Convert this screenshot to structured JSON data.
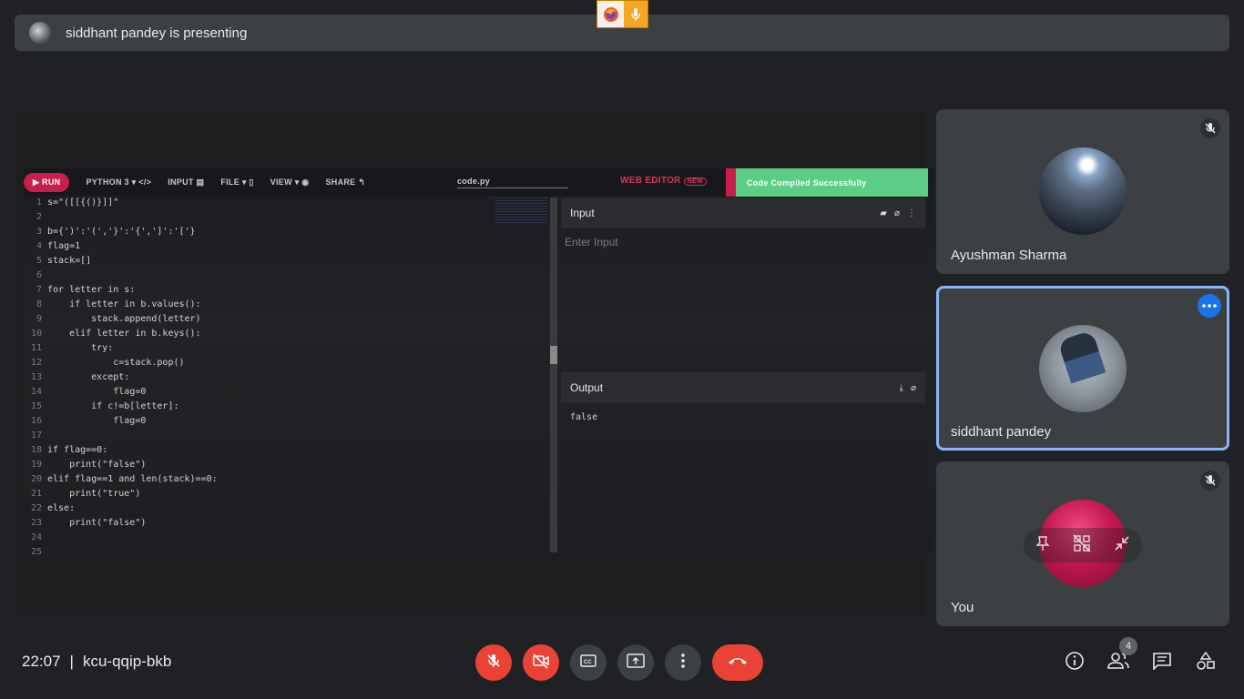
{
  "banner": {
    "text": "siddhant pandey is presenting"
  },
  "toolbar": {
    "run": "RUN",
    "language": "PYTHON 3",
    "input": "INPUT",
    "file": "FILE",
    "view": "VIEW",
    "share": "SHARE",
    "filename": "code.py",
    "brand": "WEB EDITOR",
    "brand_badge": "NEW",
    "status": "Code Compiled Successfully"
  },
  "code": {
    "lines": [
      "s=\"([[{()}]]\"",
      "",
      "b={')':'(','}':'{',']':'['}",
      "flag=1",
      "stack=[]",
      "",
      "for letter in s:",
      "    if letter in b.values():",
      "        stack.append(letter)",
      "    elif letter in b.keys():",
      "        try:",
      "            c=stack.pop()",
      "        except:",
      "            flag=0",
      "        if c!=b[letter]:",
      "            flag=0",
      "",
      "if flag==0:",
      "    print(\"false\")",
      "elif flag==1 and len(stack)==0:",
      "    print(\"true\")",
      "else:",
      "    print(\"false\")",
      "",
      ""
    ]
  },
  "io": {
    "input_title": "Input",
    "input_placeholder": "Enter Input",
    "output_title": "Output",
    "output_value": "false"
  },
  "participants": [
    {
      "name": "Ayushman Sharma"
    },
    {
      "name": "siddhant pandey"
    },
    {
      "name": "You"
    }
  ],
  "meeting": {
    "time": "22:07",
    "separator": "|",
    "code": "kcu-qqip-bkb"
  },
  "people_count": "4",
  "colors": {
    "accent": "#8ab4f8",
    "danger": "#ea4335",
    "run": "#c81e4a",
    "success": "#5ccd86"
  }
}
